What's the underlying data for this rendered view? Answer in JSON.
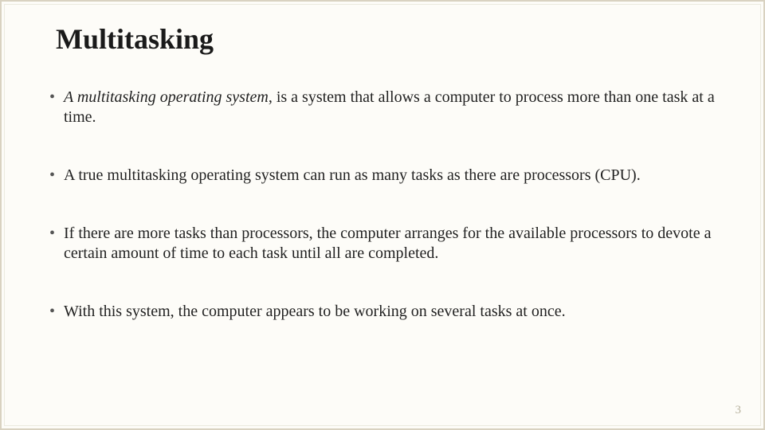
{
  "title": "Multitasking",
  "bullets": {
    "b0_lead": "A multitasking operating system",
    "b0_rest": ", is a system that allows a computer to process more than one task at a time.",
    "b1": "A true multitasking operating system can run as many tasks as there are processors (CPU).",
    "b2": "If there are more tasks than processors, the computer arranges for the available processors to devote a certain amount of time to each task until all are completed.",
    "b3": "With this system, the computer appears to be working on several tasks at once."
  },
  "page_number": "3"
}
